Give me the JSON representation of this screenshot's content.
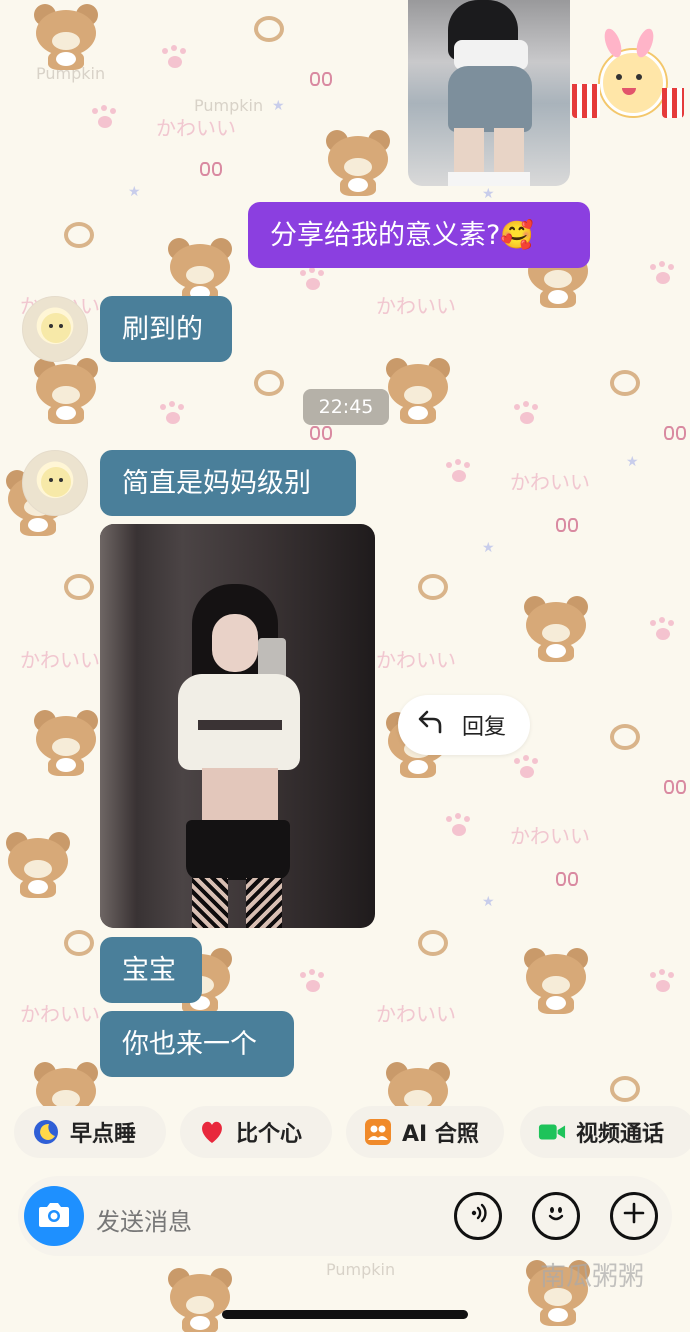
{
  "messages": [
    {
      "side": "out",
      "text": "分享给我的意义素?🥰"
    },
    {
      "side": "in",
      "text": "刷到的"
    },
    {
      "side": "in",
      "text": "简直是妈妈级别"
    },
    {
      "side": "in",
      "text": "宝宝"
    },
    {
      "side": "in",
      "text": "你也来一个"
    }
  ],
  "timestamp": "22:45",
  "reply_action": {
    "label": "回复",
    "icon": "reply-arrow-icon"
  },
  "quick_actions": [
    {
      "label": "早点睡",
      "icon": "moon-icon"
    },
    {
      "label": "比个心",
      "icon": "heart-icon"
    },
    {
      "label": "AI 合照",
      "icon": "people-icon"
    },
    {
      "label": "视频通话",
      "icon": "video-camera-icon"
    }
  ],
  "input": {
    "placeholder": "发送消息"
  },
  "wallpaper": {
    "text": "かわいい",
    "brand": "Pumpkin"
  },
  "watermark": "南瓜粥粥",
  "colors": {
    "incoming": "#4a7f9a",
    "outgoing": "#8b3fe0",
    "camera": "#1e90ff"
  }
}
